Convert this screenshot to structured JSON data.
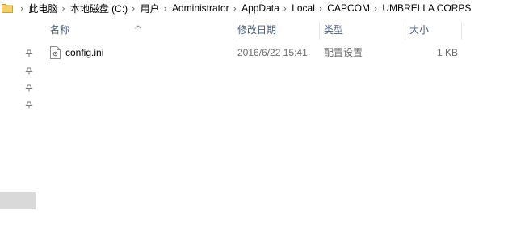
{
  "breadcrumb": {
    "items": [
      "此电脑",
      "本地磁盘 (C:)",
      "用户",
      "Administrator",
      "AppData",
      "Local",
      "CAPCOM",
      "UMBRELLA CORPS"
    ],
    "separator": "›"
  },
  "columns": {
    "name": "名称",
    "modified": "修改日期",
    "type": "类型",
    "size": "大小"
  },
  "files": [
    {
      "name": "config.ini",
      "modified": "2016/6/22 15:41",
      "type": "配置设置",
      "size": "1 KB",
      "icon": "ini-file-icon"
    }
  ],
  "nav": {
    "pins": [
      "pin-icon",
      "pin-icon",
      "pin-icon",
      "pin-icon"
    ],
    "selected_item": true
  },
  "colors": {
    "header_text": "#4c607a",
    "detail_text": "#6d6d6d",
    "nav_selected": "#d9d9d9",
    "folder": "#e8c25a"
  }
}
